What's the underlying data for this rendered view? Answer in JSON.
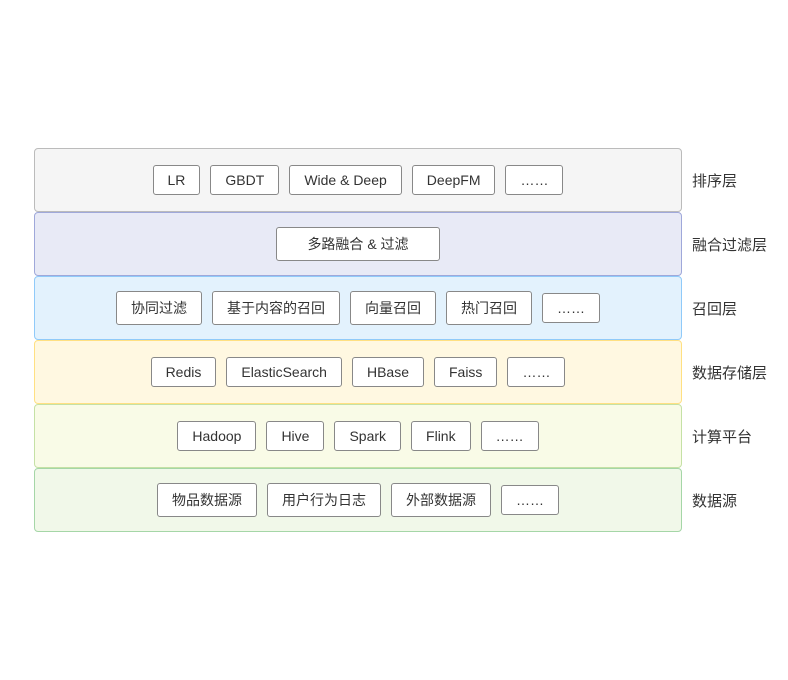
{
  "layers": [
    {
      "id": "paaixu",
      "label": "排序层",
      "colorClass": "layer-paaixu",
      "type": "items",
      "items": [
        "LR",
        "GBDT",
        "Wide & Deep",
        "DeepFM",
        "……"
      ]
    },
    {
      "id": "ronghe",
      "label": "融合过滤层",
      "colorClass": "layer-ronghe",
      "type": "single",
      "items": [
        "多路融合 & 过滤"
      ]
    },
    {
      "id": "zhaohu",
      "label": "召回层",
      "colorClass": "layer-zhaohu",
      "type": "items",
      "items": [
        "协同过滤",
        "基于内容的召回",
        "向量召回",
        "热门召回",
        "……"
      ]
    },
    {
      "id": "storage",
      "label": "数据存储层",
      "colorClass": "layer-storage",
      "type": "items",
      "items": [
        "Redis",
        "ElasticSearch",
        "HBase",
        "Faiss",
        "……"
      ]
    },
    {
      "id": "compute",
      "label": "计算平台",
      "colorClass": "layer-compute",
      "type": "items",
      "items": [
        "Hadoop",
        "Hive",
        "Spark",
        "Flink",
        "……"
      ]
    },
    {
      "id": "source",
      "label": "数据源",
      "colorClass": "layer-source",
      "type": "items",
      "items": [
        "物品数据源",
        "用户行为日志",
        "外部数据源",
        "……"
      ]
    }
  ]
}
